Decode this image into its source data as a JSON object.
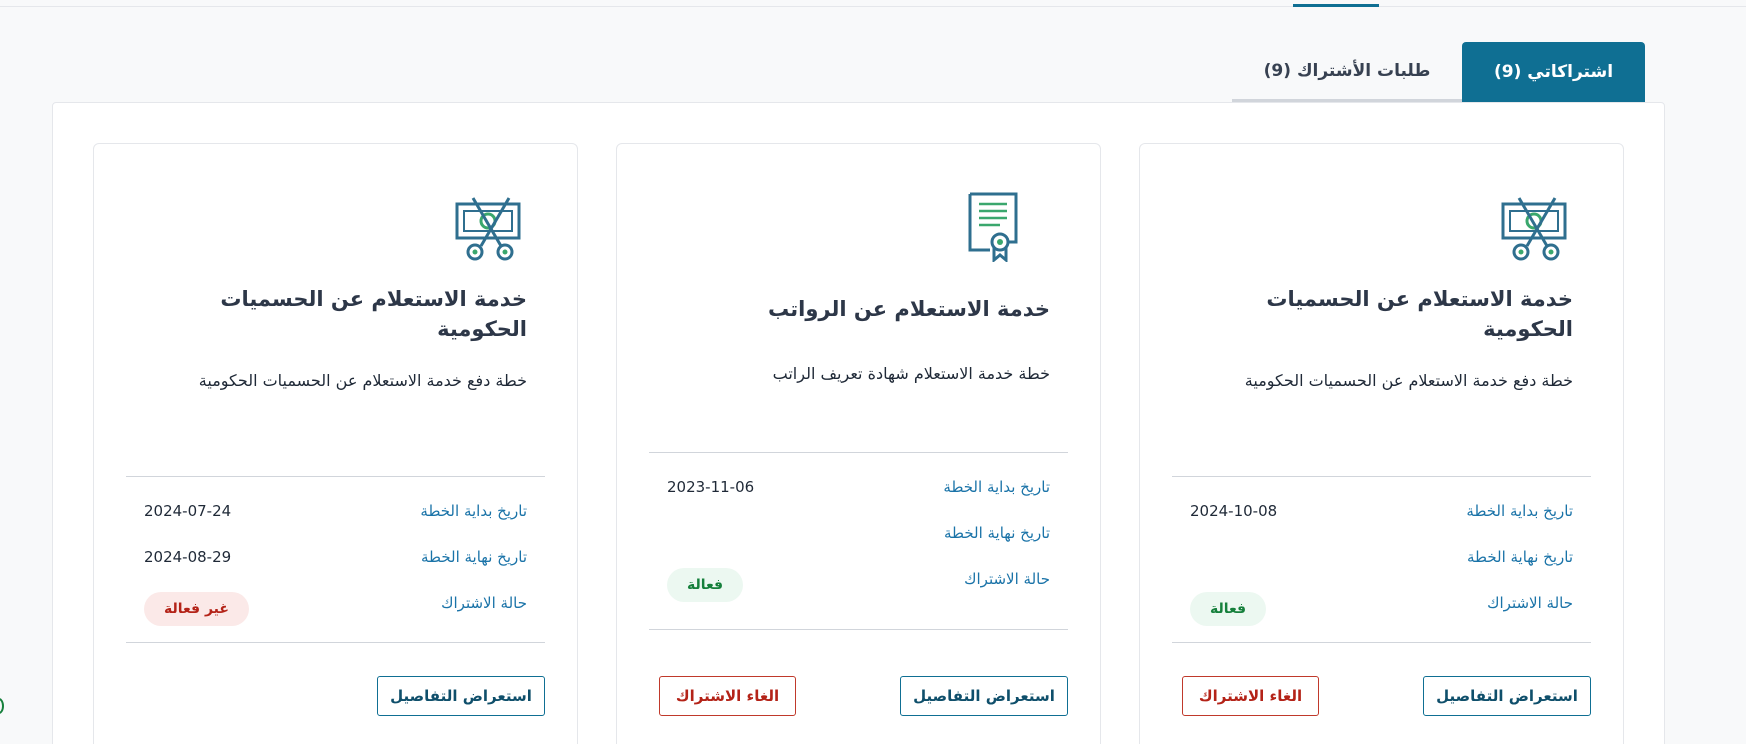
{
  "tabs": {
    "my_subscriptions": "اشتراكاتي (9)",
    "subscription_requests": "طلبات الأشتراك (9)"
  },
  "labels": {
    "start_date": "تاريخ بداية الخطة",
    "end_date": "تاريخ نهاية الخطة",
    "status": "حالة الاشتراك",
    "details_button": "استعراض التفاصيل",
    "cancel_button": "الغاء الاشتراك"
  },
  "cards": [
    {
      "title": "خدمة الاستعلام عن الحسميات الحكومية",
      "description": "خطة دفع خدمة الاستعلام عن الحسميات الحكومية",
      "start_date": "2024-10-08",
      "end_date": "",
      "status": "فعالة",
      "icon": "money-scissors-icon"
    },
    {
      "title": "خدمة الاستعلام عن الرواتب",
      "description": "خطة خدمة الاستعلام شهادة تعريف الراتب",
      "start_date": "2023-11-06",
      "end_date": "",
      "status": "فعالة",
      "icon": "certificate-icon"
    },
    {
      "title": "خدمة الاستعلام عن الحسميات الحكومية",
      "description": "خطة دفع خدمة الاستعلام عن الحسميات الحكومية",
      "start_date": "2024-07-24",
      "end_date": "2024-08-29",
      "status": "غير فعالة",
      "icon": "money-scissors-icon"
    }
  ],
  "colors": {
    "primary": "#0f6f93",
    "link": "#1a73a8",
    "active_badge_bg": "#ecf8f1",
    "active_badge_text": "#16803c",
    "inactive_badge_bg": "#fbe9e8",
    "inactive_badge_text": "#b42318",
    "icon_blue": "#2f6f8f",
    "icon_green": "#3aa76d"
  }
}
